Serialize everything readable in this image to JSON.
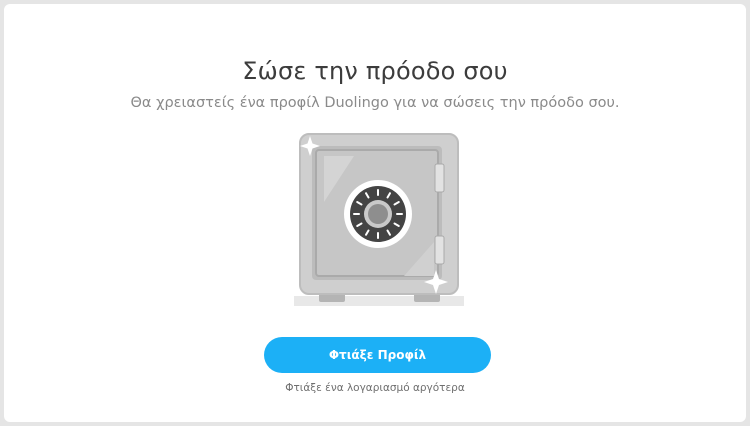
{
  "dialog": {
    "title": "Σώσε την πρόοδο σου",
    "subtitle": "Θα χρειαστείς ένα προφίλ Duolingo για να σώσεις την πρόοδο σου.",
    "primary_button_label": "Φτιάξε Προφίλ",
    "secondary_link_label": "Φτιάξε ένα λογαριασμό αργότερα"
  },
  "illustration": {
    "name": "safe-icon"
  },
  "colors": {
    "background": "#e5e5e5",
    "card": "#ffffff",
    "title": "#3c3c3c",
    "subtitle": "#8a8a8a",
    "accent": "#1cb0f6"
  }
}
